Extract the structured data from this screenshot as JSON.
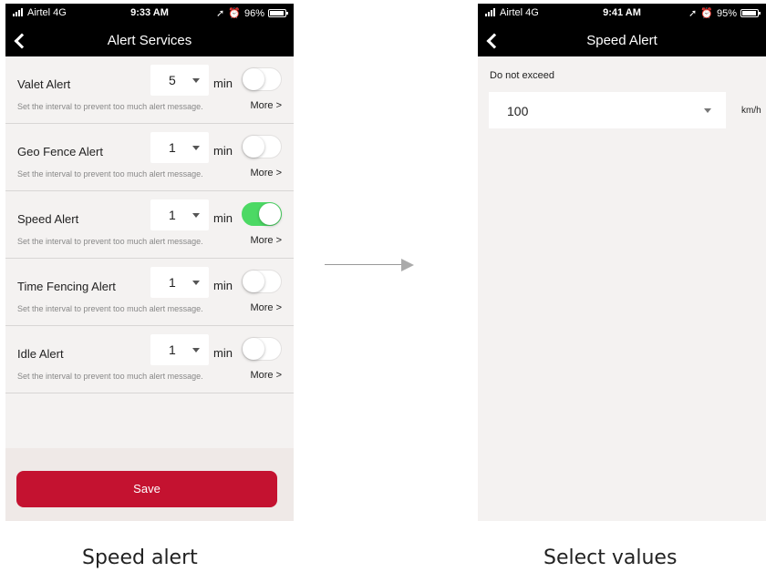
{
  "left_screen": {
    "status": {
      "carrier": "Airtel  4G",
      "time": "9:33 AM",
      "battery": "96%",
      "battery_level": 0.96
    },
    "title": "Alert Services",
    "alerts": [
      {
        "name": "Valet Alert",
        "interval": "5",
        "unit": "min",
        "enabled": false,
        "description": "Set the interval to prevent too much alert message.",
        "more": "More >"
      },
      {
        "name": "Geo Fence Alert",
        "interval": "1",
        "unit": "min",
        "enabled": false,
        "description": "Set the interval to prevent too much alert message.",
        "more": "More >"
      },
      {
        "name": "Speed Alert",
        "interval": "1",
        "unit": "min",
        "enabled": true,
        "description": "Set the interval to prevent too much alert message.",
        "more": "More >"
      },
      {
        "name": "Time Fencing Alert",
        "interval": "1",
        "unit": "min",
        "enabled": false,
        "description": "Set the interval to prevent too much alert message.",
        "more": "More >"
      },
      {
        "name": "Idle Alert",
        "interval": "1",
        "unit": "min",
        "enabled": false,
        "description": "Set the interval to prevent too much alert message.",
        "more": "More >"
      }
    ],
    "save_label": "Save",
    "caption": "Speed alert"
  },
  "right_screen": {
    "status": {
      "carrier": "Airtel  4G",
      "time": "9:41 AM",
      "battery": "95%",
      "battery_level": 0.95
    },
    "title": "Speed Alert",
    "field_label": "Do not exceed",
    "speed_value": "100",
    "speed_unit": "km/h",
    "caption": "Select values"
  },
  "colors": {
    "accent": "#c41230",
    "toggle_on": "#4cd964",
    "topbar": "#000000",
    "background": "#f4f2f1"
  },
  "icons": {
    "back": "chevron-left-icon",
    "location": "location-arrow-icon",
    "alarm": "alarm-icon",
    "arrow": "right-arrow-icon"
  }
}
